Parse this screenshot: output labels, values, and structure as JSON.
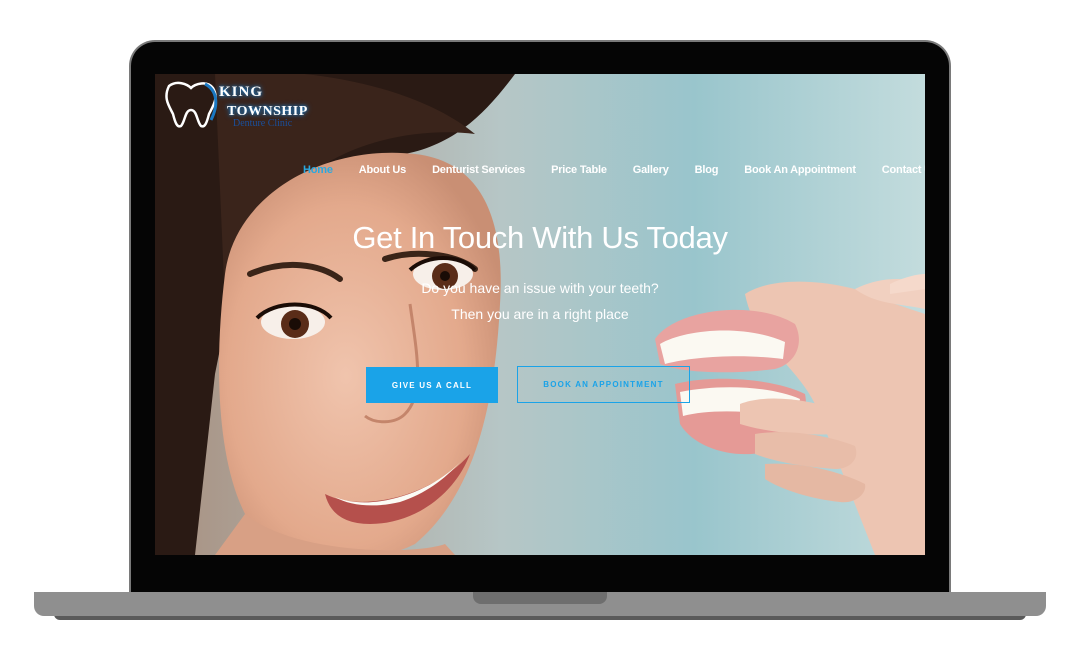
{
  "logo": {
    "line1": "KING",
    "line2": "TOWNSHIP",
    "line3": "Denture Clinic"
  },
  "nav": {
    "items": [
      {
        "label": "Home",
        "active": true
      },
      {
        "label": "About Us",
        "active": false
      },
      {
        "label": "Denturist Services",
        "active": false
      },
      {
        "label": "Price Table",
        "active": false
      },
      {
        "label": "Gallery",
        "active": false
      },
      {
        "label": "Blog",
        "active": false
      },
      {
        "label": "Book An Appointment",
        "active": false
      },
      {
        "label": "Contact Us",
        "active": false
      }
    ]
  },
  "hero": {
    "title": "Get In Touch With Us Today",
    "subtitle_line1": "Do you have an issue with your teeth?",
    "subtitle_line2": "Then you are in a right place",
    "primary_button": "GIVE US A CALL",
    "secondary_button": "BOOK AN APPOINTMENT"
  },
  "colors": {
    "accent": "#1aa3e8",
    "nav_active": "#29a8e0",
    "laptop_frame": "#050505",
    "laptop_base": "#8f8f8f"
  }
}
